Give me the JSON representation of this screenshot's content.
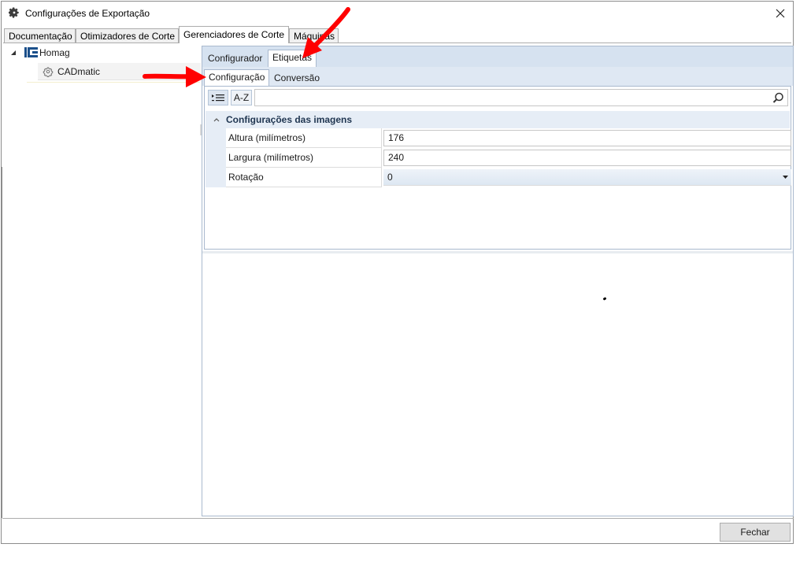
{
  "window": {
    "title": "Configurações de Exportação",
    "title_icon": "gear-icon",
    "close_icon": "close-icon"
  },
  "main_tabs": [
    {
      "label": "Documentação",
      "active": false
    },
    {
      "label": "Otimizadores de Corte",
      "active": false
    },
    {
      "label": "Gerenciadores de Corte",
      "active": true
    },
    {
      "label": "Máquinas",
      "active": false
    }
  ],
  "tree": {
    "root": {
      "label": "Homag",
      "icon": "homag-logo-icon",
      "expanded": true
    },
    "child": {
      "label": "CADmatic",
      "icon": "cog-icon",
      "selected": true
    }
  },
  "sub_tabs": [
    {
      "label": "Configurador",
      "active": false
    },
    {
      "label": "Etiquetas",
      "active": true
    }
  ],
  "inner_tabs": [
    {
      "label": "Configuração",
      "active": true
    },
    {
      "label": "Conversão",
      "active": false
    }
  ],
  "toolbar": {
    "categorized_icon": "categorized-list-icon",
    "alpha_label": "A-Z",
    "search_value": "",
    "search_icon": "search-icon"
  },
  "property_group": {
    "title": "Configurações das imagens",
    "properties": [
      {
        "name": "Altura (milímetros)",
        "value": "176",
        "type": "text"
      },
      {
        "name": "Largura (milímetros)",
        "value": "240",
        "type": "text"
      },
      {
        "name": "Rotação",
        "value": "0",
        "type": "combo"
      }
    ]
  },
  "footer": {
    "close_button_label": "Fechar"
  },
  "colors": {
    "annotation_arrow": "#ff0000",
    "panel_header": "#d6e2f0",
    "group_header": "#e6edf6"
  }
}
